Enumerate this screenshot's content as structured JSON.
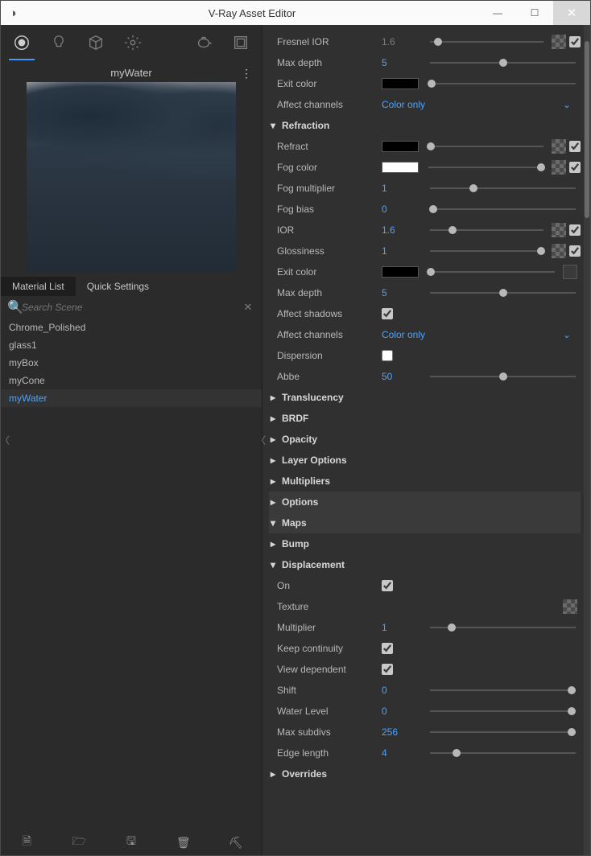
{
  "window": {
    "title": "V-Ray Asset Editor"
  },
  "preview": {
    "materialName": "myWater"
  },
  "tabs": {
    "material": "Material List",
    "quick": "Quick Settings"
  },
  "search": {
    "placeholder": "Search Scene"
  },
  "materials": [
    "Chrome_Polished",
    "glass1",
    "myBox",
    "myCone",
    "myWater"
  ],
  "materialsSelected": 4,
  "props": {
    "fresnelIOR": {
      "label": "Fresnel IOR",
      "value": "1.6",
      "pos": 7,
      "checker": true,
      "cb": true,
      "gray": true
    },
    "maxDepth1": {
      "label": "Max depth",
      "value": "5",
      "pos": 50
    },
    "exitColor1": {
      "label": "Exit color",
      "color": "#000000",
      "pos": 2
    },
    "affectCh1": {
      "label": "Affect channels",
      "option": "Color only"
    },
    "sec_refraction": "Refraction",
    "refract": {
      "label": "Refract",
      "color": "#000000",
      "pos": 2,
      "checker": true,
      "cb": true
    },
    "fogColor": {
      "label": "Fog color",
      "color": "#ffffff",
      "pos": 98,
      "checker": true,
      "cb": true
    },
    "fogMult": {
      "label": "Fog multiplier",
      "value": "1",
      "pos": 30
    },
    "fogBias": {
      "label": "Fog bias",
      "value": "0",
      "pos": 2
    },
    "ior": {
      "label": "IOR",
      "value": "1.6",
      "pos": 20,
      "checker": true,
      "cb": true
    },
    "glossiness": {
      "label": "Glossiness",
      "value": "1",
      "pos": 98,
      "checker": true,
      "cb": true
    },
    "exitColor2": {
      "label": "Exit color",
      "color": "#000000",
      "pos": 2,
      "emptyBox": true
    },
    "maxDepth2": {
      "label": "Max depth",
      "value": "5",
      "pos": 50
    },
    "affectShadows": {
      "label": "Affect shadows",
      "cb": true
    },
    "affectCh2": {
      "label": "Affect channels",
      "option": "Color only"
    },
    "dispersion": {
      "label": "Dispersion",
      "cb": false
    },
    "abbe": {
      "label": "Abbe",
      "value": "50",
      "pos": 50
    },
    "sec_translucency": "Translucency",
    "sec_brdf": "BRDF",
    "sec_opacity": "Opacity",
    "sec_layer": "Layer Options",
    "sec_mult": "Multipliers",
    "sec_options": "Options",
    "sec_maps": "Maps",
    "sec_bump": "Bump",
    "sec_disp": "Displacement",
    "dOn": {
      "label": "On",
      "cb": true
    },
    "dTexture": {
      "label": "Texture",
      "checkerOnly": true
    },
    "dMult": {
      "label": "Multiplier",
      "value": "1",
      "pos": 15
    },
    "dKeep": {
      "label": "Keep continuity",
      "cb": true
    },
    "dView": {
      "label": "View dependent",
      "cb": true
    },
    "dShift": {
      "label": "Shift",
      "value": "0",
      "pos": 97
    },
    "dWater": {
      "label": "Water Level",
      "value": "0",
      "pos": 97
    },
    "dMaxSub": {
      "label": "Max subdivs",
      "value": "256",
      "pos": 97
    },
    "dEdge": {
      "label": "Edge length",
      "value": "4",
      "pos": 18
    },
    "sec_overrides": "Overrides"
  }
}
